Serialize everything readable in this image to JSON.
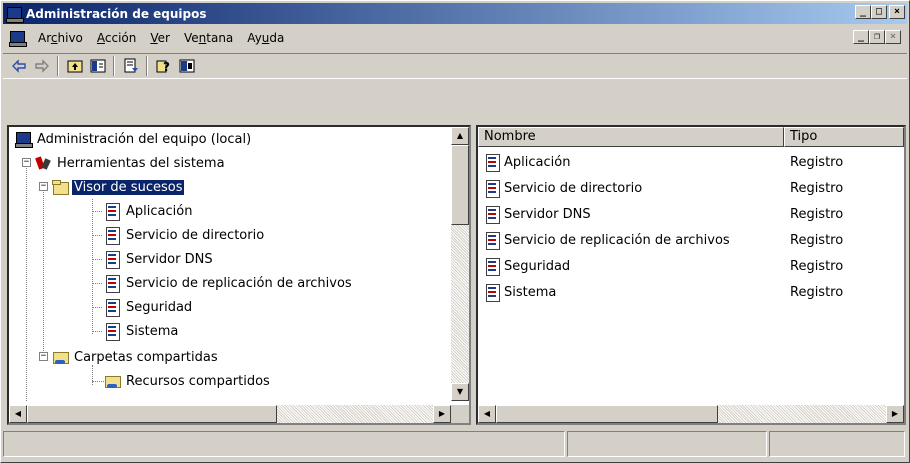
{
  "window": {
    "title": "Administración de equipos",
    "titlebar_color": "#0a246a"
  },
  "caption_buttons": {
    "minimize": "_",
    "maximize": "□",
    "close": "×"
  },
  "mdi_buttons": {
    "minimize": "_",
    "restore": "❐",
    "close": "×"
  },
  "menu": {
    "items": [
      {
        "pre": "Ar",
        "accel": "c",
        "post": "hivo"
      },
      {
        "pre": "",
        "accel": "A",
        "post": "cción"
      },
      {
        "pre": "",
        "accel": "V",
        "post": "er"
      },
      {
        "pre": "Ve",
        "accel": "n",
        "post": "tana"
      },
      {
        "pre": "Ay",
        "accel": "u",
        "post": "da"
      }
    ]
  },
  "toolbar": {
    "buttons": [
      "back-icon",
      "forward-icon",
      "up-folder-icon",
      "show-tree-icon",
      "export-list-icon",
      "help-icon",
      "console-view-icon"
    ]
  },
  "tree": {
    "root": "Administración del equipo (local)",
    "tools": "Herramientas del sistema",
    "event_viewer": "Visor de sucesos",
    "logs": [
      "Aplicación",
      "Servicio de directorio",
      "Servidor DNS",
      "Servicio de replicación de archivos",
      "Seguridad",
      "Sistema"
    ],
    "shared_folders": "Carpetas compartidas",
    "shares": "Recursos compartidos",
    "expander_minus": "−"
  },
  "list": {
    "columns": {
      "name": "Nombre",
      "type": "Tipo"
    },
    "rows": [
      {
        "name": "Aplicación",
        "type": "Registro"
      },
      {
        "name": "Servicio de directorio",
        "type": "Registro"
      },
      {
        "name": "Servidor DNS",
        "type": "Registro"
      },
      {
        "name": "Servicio de replicación de archivos",
        "type": "Registro"
      },
      {
        "name": "Seguridad",
        "type": "Registro"
      },
      {
        "name": "Sistema",
        "type": "Registro"
      }
    ]
  },
  "scroll_arrows": {
    "up": "▲",
    "down": "▼",
    "left": "◀",
    "right": "▶"
  }
}
